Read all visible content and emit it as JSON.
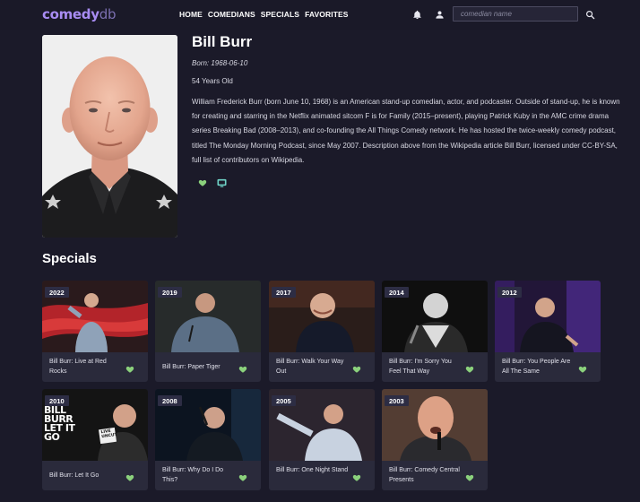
{
  "nav": {
    "logo_bold": "comedy",
    "logo_light": "db",
    "links": [
      "HOME",
      "COMEDIANS",
      "SPECIALS",
      "FAVORITES"
    ],
    "search_placeholder": "comedian name",
    "icons": [
      "bell-icon",
      "user-icon",
      "search-icon"
    ]
  },
  "comedian": {
    "name": "Bill Burr",
    "born": "Born: 1968-06-10",
    "age": "54 Years Old",
    "bio": "William Frederick Burr (born June 10, 1968) is an American stand-up comedian, actor, and podcaster. Outside of stand-up, he is known for creating and starring in the Netflix animated sitcom F is for Family (2015–present), playing Patrick Kuby in the AMC crime drama series Breaking Bad (2008–2013), and co-founding the All Things Comedy network. He has hosted the twice-weekly comedy podcast, titled The Monday Morning Podcast, since May 2007. Description above from the Wikipedia article Bill Burr, licensed under CC-BY-SA, full list of contributors on Wikipedia."
  },
  "specials_title": "Specials",
  "specials": [
    {
      "year": "2022",
      "title": "Bill Burr: Live at Red Rocks"
    },
    {
      "year": "2019",
      "title": "Bill Burr: Paper Tiger"
    },
    {
      "year": "2017",
      "title": "Bill Burr: Walk Your Way Out"
    },
    {
      "year": "2014",
      "title": "Bill Burr: I'm Sorry You Feel That Way"
    },
    {
      "year": "2012",
      "title": "Bill Burr: You People Are All The Same"
    },
    {
      "year": "2010",
      "title": "Bill Burr: Let It Go",
      "poster_text": "BILL BURR LET IT GO",
      "badge_text": "LIVE UNCUT"
    },
    {
      "year": "2008",
      "title": "Bill Burr: Why Do I Do This?"
    },
    {
      "year": "2005",
      "title": "Bill Burr: One Night Stand"
    },
    {
      "year": "2003",
      "title": "Bill Burr: Comedy Central Presents"
    }
  ],
  "colors": {
    "background": "#1b1a29",
    "card": "#2a2a3b",
    "accent_purple": "#a88cf2",
    "heart_green": "#8bd17c",
    "tv_teal": "#6fd3c7"
  }
}
